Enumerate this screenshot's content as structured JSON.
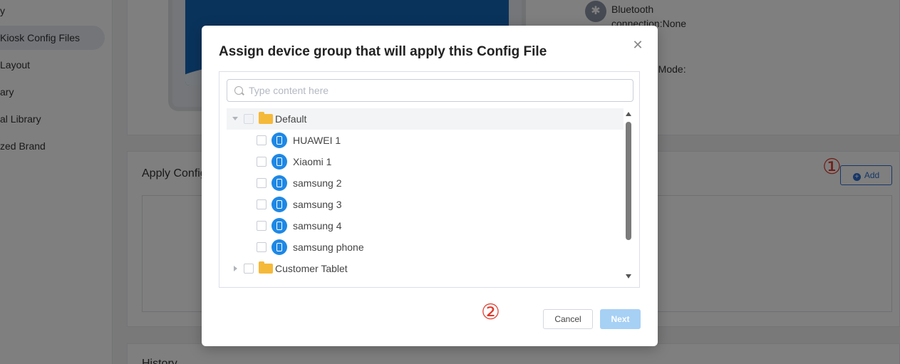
{
  "sidebar": {
    "items": [
      {
        "label": "y"
      },
      {
        "label": "Kiosk Config Files"
      },
      {
        "label": "Layout"
      },
      {
        "label": "ary"
      },
      {
        "label": "al Library"
      },
      {
        "label": "zed Brand"
      }
    ]
  },
  "page": {
    "bluetooth_label": "Bluetooth",
    "bluetooth_value": "connection:None",
    "kiosk_mode_label": "o Mode:",
    "apply_config_title": "Apply Config",
    "add_button_label": "Add",
    "history_title": "History",
    "annotation_1": "①",
    "annotation_2": "②"
  },
  "modal": {
    "title": "Assign device group that will apply this Config File",
    "search_placeholder": "Type content here",
    "tree": [
      {
        "type": "group",
        "label": "Default",
        "expanded": true,
        "devices": [
          {
            "label": "HUAWEI 1"
          },
          {
            "label": "Xiaomi 1"
          },
          {
            "label": "samsung 2"
          },
          {
            "label": "samsung 3"
          },
          {
            "label": "samsung 4"
          },
          {
            "label": "samsung phone"
          }
        ]
      },
      {
        "type": "group",
        "label": "Customer Tablet",
        "expanded": false
      }
    ],
    "cancel_label": "Cancel",
    "next_label": "Next"
  },
  "colors": {
    "accent": "#2f6fd0",
    "device_icon": "#1e88e5",
    "folder": "#f5b93a",
    "annotation": "#e0392b",
    "next_disabled": "#a7d0f5"
  },
  "icons": {
    "close": "close-icon",
    "search": "search-icon",
    "folder": "folder-icon",
    "device": "phone-icon",
    "bluetooth": "bluetooth-icon",
    "add": "plus-circle-icon"
  }
}
